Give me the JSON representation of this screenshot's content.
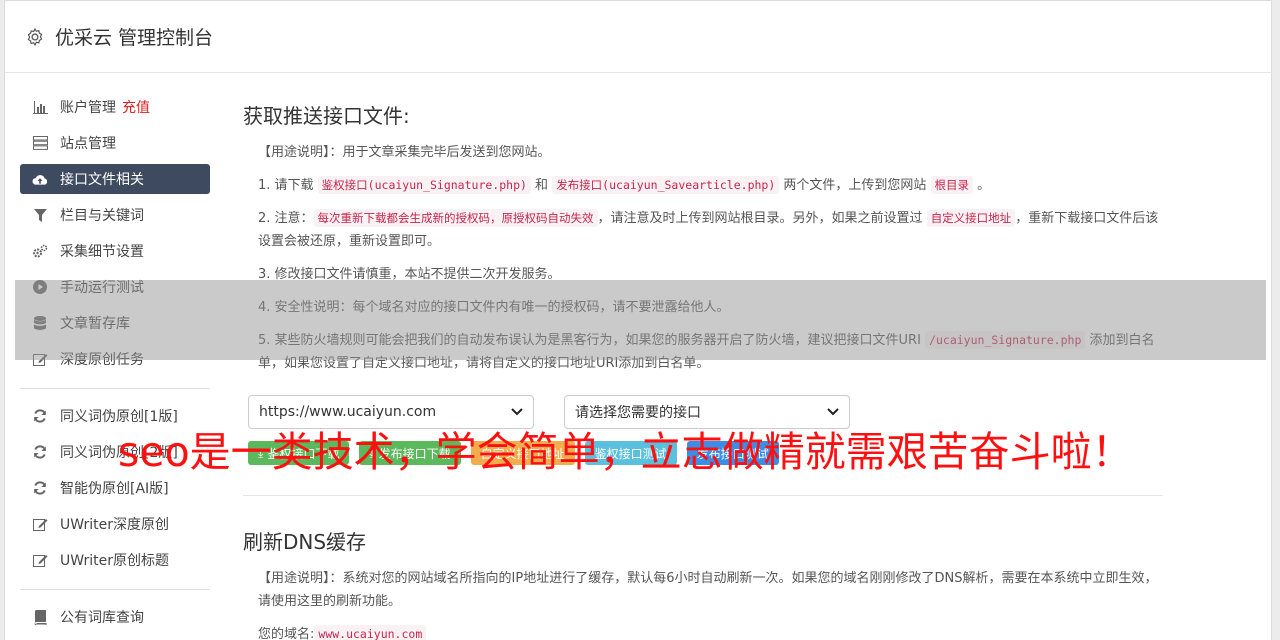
{
  "app": {
    "title": "优采云 管理控制台",
    "icon": "gear-icon"
  },
  "sidebar": {
    "items": [
      {
        "label": "账户管理",
        "extra": "充值",
        "icon": "bar-chart-icon"
      },
      {
        "label": "站点管理",
        "icon": "server-icon"
      },
      {
        "label": "接口文件相关",
        "icon": "cloud-upload-icon",
        "active": true
      },
      {
        "label": "栏目与关键词",
        "icon": "filter-icon"
      },
      {
        "label": "采集细节设置",
        "icon": "cogs-icon"
      },
      {
        "label": "手动运行测试",
        "icon": "play-circle-icon"
      },
      {
        "label": "文章暂存库",
        "icon": "database-icon"
      },
      {
        "label": "深度原创任务",
        "icon": "edit-icon"
      }
    ],
    "items2": [
      {
        "label": "同义词伪原创[1版]",
        "icon": "refresh-icon"
      },
      {
        "label": "同义词伪原创[2版]",
        "icon": "refresh-icon"
      },
      {
        "label": "智能伪原创[AI版]",
        "icon": "refresh-icon"
      },
      {
        "label": "UWriter深度原创",
        "icon": "edit-icon"
      },
      {
        "label": "UWriter原创标题",
        "icon": "edit-icon"
      }
    ],
    "items3": [
      {
        "label": "公有词库查询",
        "icon": "book-icon"
      }
    ]
  },
  "section1": {
    "title": "获取推送接口文件:",
    "usage_label": "【用途说明】：",
    "usage_text": "用于文章采集完毕后发送到您网站。",
    "p1_a": "1. 请下载 ",
    "p1_code1": "鉴权接口(ucaiyun_Signature.php)",
    "p1_b": " 和 ",
    "p1_code2": "发布接口(ucaiyun_Savearticle.php)",
    "p1_c": " 两个文件，上传到您网站 ",
    "p1_code3": "根目录",
    "p1_d": " 。",
    "p2_a": "2. 注意：",
    "p2_code1": "每次重新下载都会生成新的授权码，原授权码自动失效",
    "p2_b": "，请注意及时上传到网站根目录。另外，如果之前设置过 ",
    "p2_code2": "自定义接口地址",
    "p2_c": "，重新下载接口文件后该设置会被还原，重新设置即可。",
    "p3": "3. 修改接口文件请慎重，本站不提供二次开发服务。",
    "p4": "4. 安全性说明：每个域名对应的接口文件内有唯一的授权码，请不要泄露给他人。",
    "p5_a": "5. 某些防火墙规则可能会把我们的自动发布误认为是黑客行为，如果您的服务器开启了防火墙，建议把接口文件URI ",
    "p5_code": "/ucaiyun_Signature.php",
    "p5_b": " 添加到白名单，如果您设置了自定义接口地址，请将自定义的接口地址URI添加到白名单。",
    "select1_value": "https://www.ucaiyun.com",
    "select2_value": "请选择您需要的接口",
    "buttons": [
      {
        "label": "鉴权接口下载",
        "color": "#5cb85c"
      },
      {
        "label": "发布接口下载",
        "color": "#5cb85c"
      },
      {
        "label": "自定义接口地址",
        "color": "#f0ad4e"
      },
      {
        "label": "鉴权接口测试",
        "color": "#5bc0de"
      },
      {
        "label": "发布接口测试",
        "color": "#3a8ee6"
      }
    ]
  },
  "section2": {
    "title": "刷新DNS缓存",
    "usage_label": "【用途说明】：",
    "usage_text": "系统对您的网站域名所指向的IP地址进行了缓存，默认每6小时自动刷新一次。如果您的域名刚刚修改了DNS解析，需要在本系统中立即生效，请使用这里的刷新功能。",
    "domain_label": "您的域名:",
    "domain_value": "www.ucaiyun.com"
  },
  "watermark": {
    "text": "seo是一类技术，学会简单，立志做精就需艰苦奋斗啦！"
  }
}
